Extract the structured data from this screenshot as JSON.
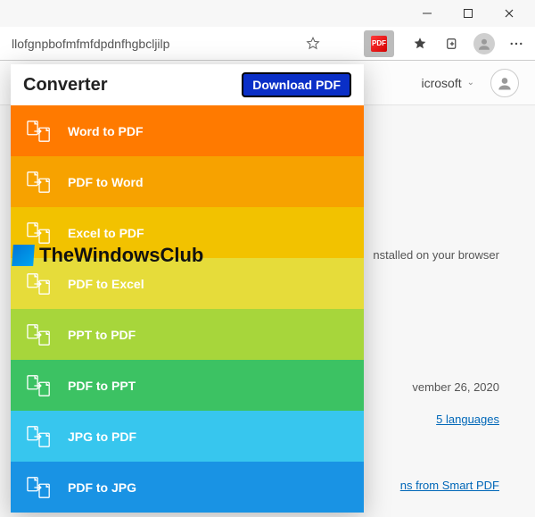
{
  "window": {
    "address_url": "llofgnpbofmfmfdpdnfhgbcljilp"
  },
  "content": {
    "microsoft_label": "icrosoft",
    "installed_hint": "nstalled on your browser",
    "update_date": "vember 26, 2020",
    "languages_link": "5 languages",
    "extensions_link": "ns from Smart PDF"
  },
  "popup": {
    "title": "Converter",
    "download_button": "Download PDF",
    "items": [
      {
        "label": "Word to PDF",
        "color": "#ff7a00"
      },
      {
        "label": "PDF to Word",
        "color": "#f7a200"
      },
      {
        "label": "Excel to PDF",
        "color": "#f2c200"
      },
      {
        "label": "PDF to Excel",
        "color": "#e6dc3a"
      },
      {
        "label": "PPT to PDF",
        "color": "#a7d63b"
      },
      {
        "label": "PDF to PPT",
        "color": "#3cc263"
      },
      {
        "label": "JPG to PDF",
        "color": "#37c6ee"
      },
      {
        "label": "PDF to JPG",
        "color": "#1993e4"
      }
    ]
  },
  "watermark": "TheWindowsClub"
}
